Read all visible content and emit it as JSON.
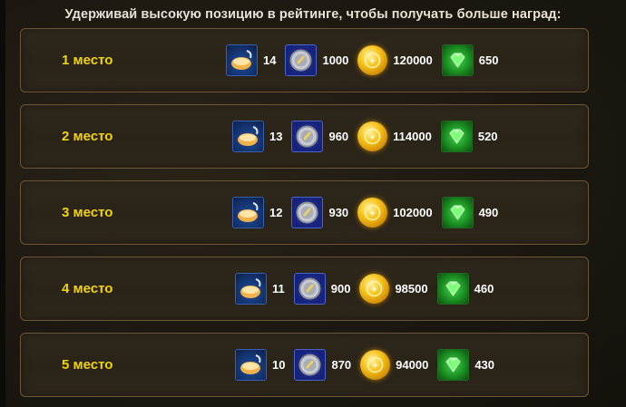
{
  "header": "Удерживай высокую позицию в рейтинге, чтобы получать больше наград:",
  "rows": [
    {
      "place": "1 место",
      "scrolls": "14",
      "arena_coins": "1000",
      "gold": "120000",
      "emeralds": "650"
    },
    {
      "place": "2 место",
      "scrolls": "13",
      "arena_coins": "960",
      "gold": "114000",
      "emeralds": "520"
    },
    {
      "place": "3 место",
      "scrolls": "12",
      "arena_coins": "930",
      "gold": "102000",
      "emeralds": "490"
    },
    {
      "place": "4 место",
      "scrolls": "11",
      "arena_coins": "900",
      "gold": "98500",
      "emeralds": "460"
    },
    {
      "place": "5 место",
      "scrolls": "10",
      "arena_coins": "870",
      "gold": "94000",
      "emeralds": "430"
    }
  ],
  "icons": {
    "scrolls": "scroll-icon",
    "arena_coins": "arena-coin-icon",
    "gold": "gold-coin-icon",
    "emeralds": "emerald-icon"
  },
  "colors": {
    "place_text": "#f3d400",
    "value_text": "#ffffff",
    "row_border": "#6b5738"
  }
}
